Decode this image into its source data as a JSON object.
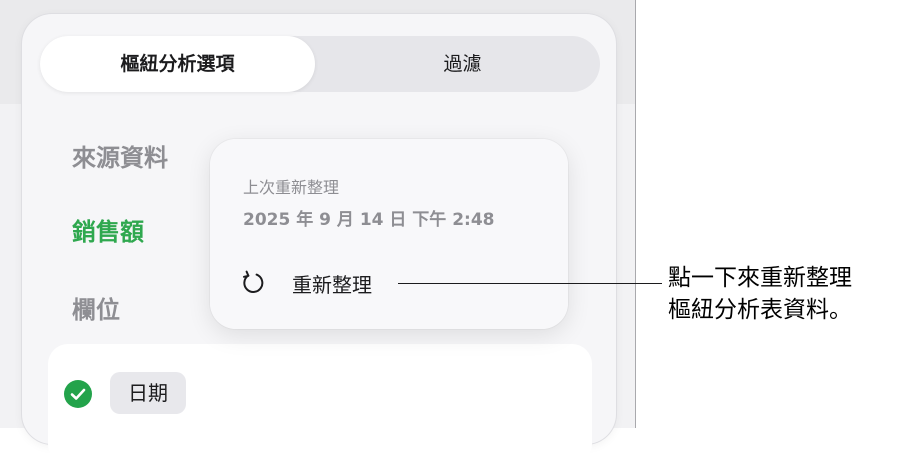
{
  "tabs": {
    "options_label": "樞紐分析選項",
    "filter_label": "過濾"
  },
  "sidebar": {
    "source_header": "來源資料",
    "source_item": "銷售額",
    "fields_header": "欄位"
  },
  "fields": {
    "items": [
      {
        "label": "日期",
        "checked": true
      }
    ]
  },
  "popover": {
    "title": "上次重新整理",
    "timestamp": "2025 年 9 月 14 日 下午 2:48",
    "refresh_label": "重新整理",
    "refresh_icon": "refresh-icon"
  },
  "callout": {
    "line1": "點一下來重新整理",
    "line2": "樞紐分析表資料。"
  },
  "colors": {
    "accent_green": "#2fa84f",
    "check_green": "#23a34b"
  }
}
